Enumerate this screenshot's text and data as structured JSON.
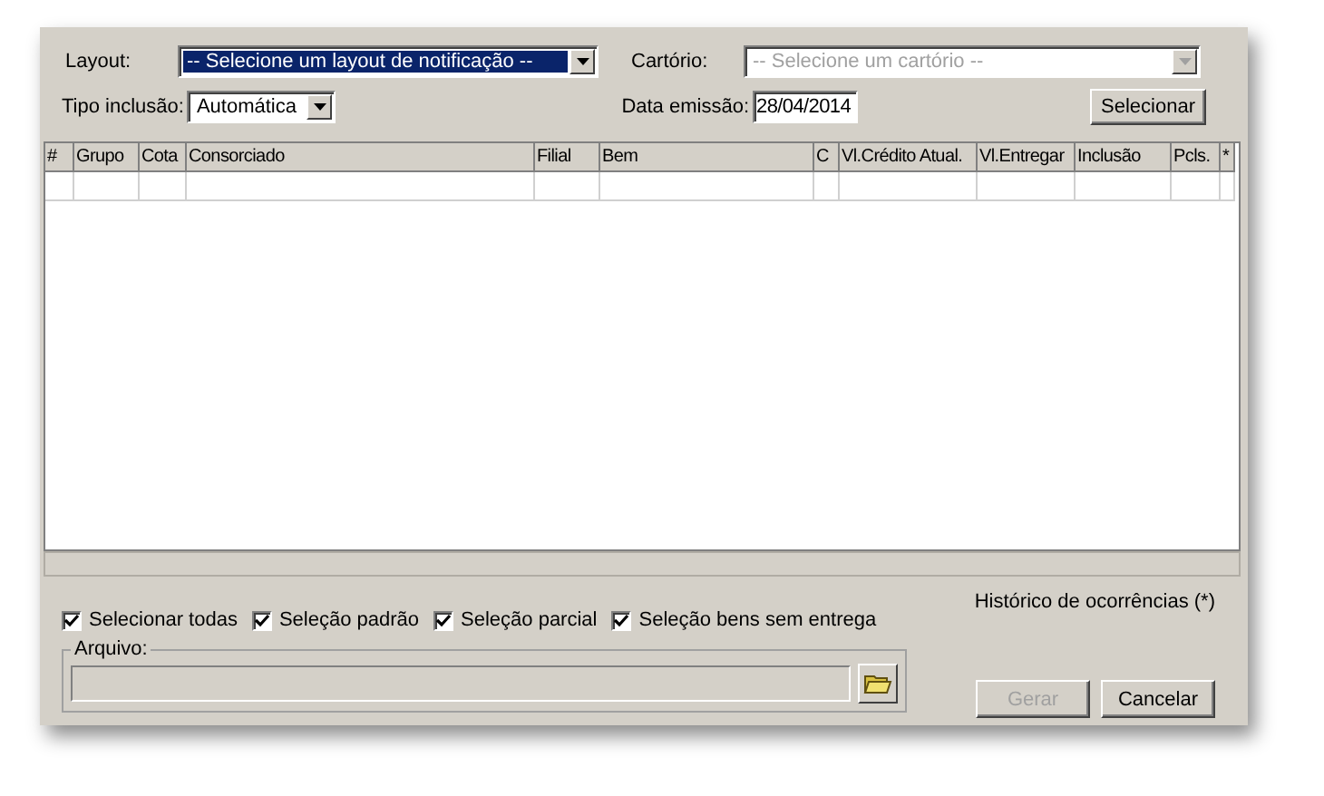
{
  "form": {
    "layout_label": "Layout:",
    "layout_select": {
      "value": "-- Selecione um layout de notificação --",
      "selected": true
    },
    "cartorio_label": "Cartório:",
    "cartorio_select": {
      "value": "-- Selecione um cartório --",
      "disabled": true
    },
    "tipo_label": "Tipo inclusão:",
    "tipo_select": {
      "value": "Automática"
    },
    "data_label": "Data emissão:",
    "data_field": {
      "value": "28/04/2014"
    },
    "select_button": "Selecionar"
  },
  "table": {
    "columns": [
      "#",
      "Grupo",
      "Cota",
      "Consorciado",
      "Filial",
      "Bem",
      "C",
      "Vl.Crédito Atual.",
      "Vl.Entregar",
      "Inclusão",
      "Pcls.",
      "*"
    ]
  },
  "checkboxes": [
    {
      "label": "Selecionar todas",
      "checked": true
    },
    {
      "label": "Seleção padrão",
      "checked": true
    },
    {
      "label": "Seleção parcial",
      "checked": true
    },
    {
      "label": "Seleção bens sem entrega",
      "checked": true
    }
  ],
  "historico": "Histórico de ocorrências (*)",
  "arquivo": {
    "legend": "Arquivo:"
  },
  "buttons": [
    {
      "label": "Gerar",
      "disabled": true
    },
    {
      "label": "Cancelar",
      "disabled": false
    }
  ]
}
